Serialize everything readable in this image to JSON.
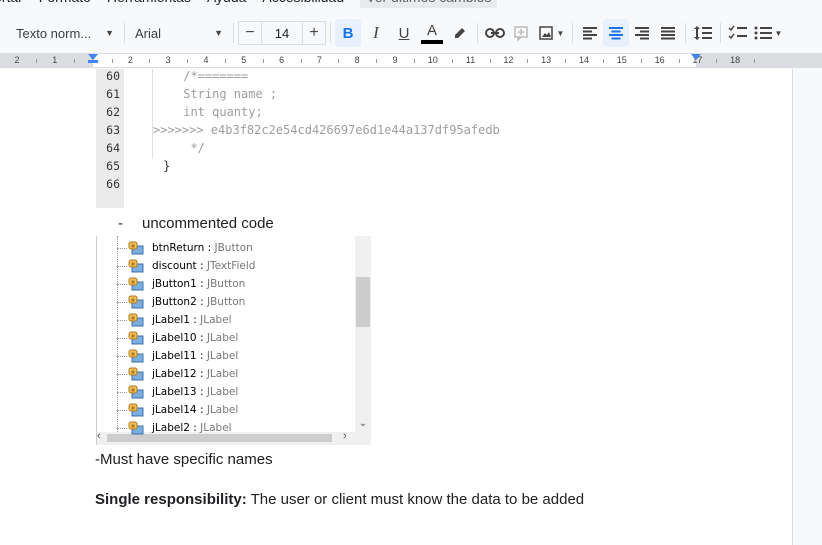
{
  "menubar": {
    "items": [
      "ertar",
      "Formato",
      "Herramientas",
      "Ayuda",
      "Accesibilidad"
    ],
    "last_edit": "Ver últimos cambios"
  },
  "toolbar": {
    "style_select": "Texto norm...",
    "font_select": "Arial",
    "font_size": "14",
    "minus_label": "−",
    "plus_label": "+",
    "bold_label": "B",
    "italic_label": "I",
    "underline_label": "U",
    "text_color_label": "A",
    "text_color": "#000000",
    "active_color": "#1a73e8"
  },
  "ruler": {
    "labels": [
      "2",
      "1",
      "1",
      "2",
      "3",
      "4",
      "5",
      "6",
      "7",
      "8",
      "9",
      "10",
      "11",
      "12",
      "13",
      "14",
      "15",
      "16",
      "17",
      "18"
    ]
  },
  "code": {
    "lines": [
      {
        "n": "60",
        "text": "/*=======",
        "plain": false
      },
      {
        "n": "61",
        "text": "String name ;",
        "plain": false
      },
      {
        "n": "62",
        "text": "int quanty;",
        "plain": false
      },
      {
        "n": "63",
        "text": ">>>>>>> e4b3f82c2e54cd426697e6d1e44a137df95afedb",
        "plain": false
      },
      {
        "n": "64",
        "text": " */",
        "plain": false
      },
      {
        "n": "65",
        "text": "}",
        "plain": true
      },
      {
        "n": "66",
        "text": "",
        "plain": true
      }
    ]
  },
  "bullet": {
    "marker": "-",
    "text": "uncommented code"
  },
  "tree": {
    "rows": [
      {
        "name": "btnReturn",
        "type": "JButton"
      },
      {
        "name": "discount",
        "type": "JTextField"
      },
      {
        "name": "jButton1",
        "type": "JButton"
      },
      {
        "name": "jButton2",
        "type": "JButton"
      },
      {
        "name": "jLabel1",
        "type": "JLabel"
      },
      {
        "name": "jLabel10",
        "type": "JLabel"
      },
      {
        "name": "jLabel11",
        "type": "JLabel"
      },
      {
        "name": "jLabel12",
        "type": "JLabel"
      },
      {
        "name": "jLabel13",
        "type": "JLabel"
      },
      {
        "name": "jLabel14",
        "type": "JLabel"
      },
      {
        "name": "jLabel2",
        "type": "JLabel"
      }
    ],
    "separator": " : "
  },
  "paragraphs": {
    "p1": "-Must have specific names",
    "p2_bold": "Single responsibility:",
    "p2_rest": " The user or client must know the data to be added"
  }
}
